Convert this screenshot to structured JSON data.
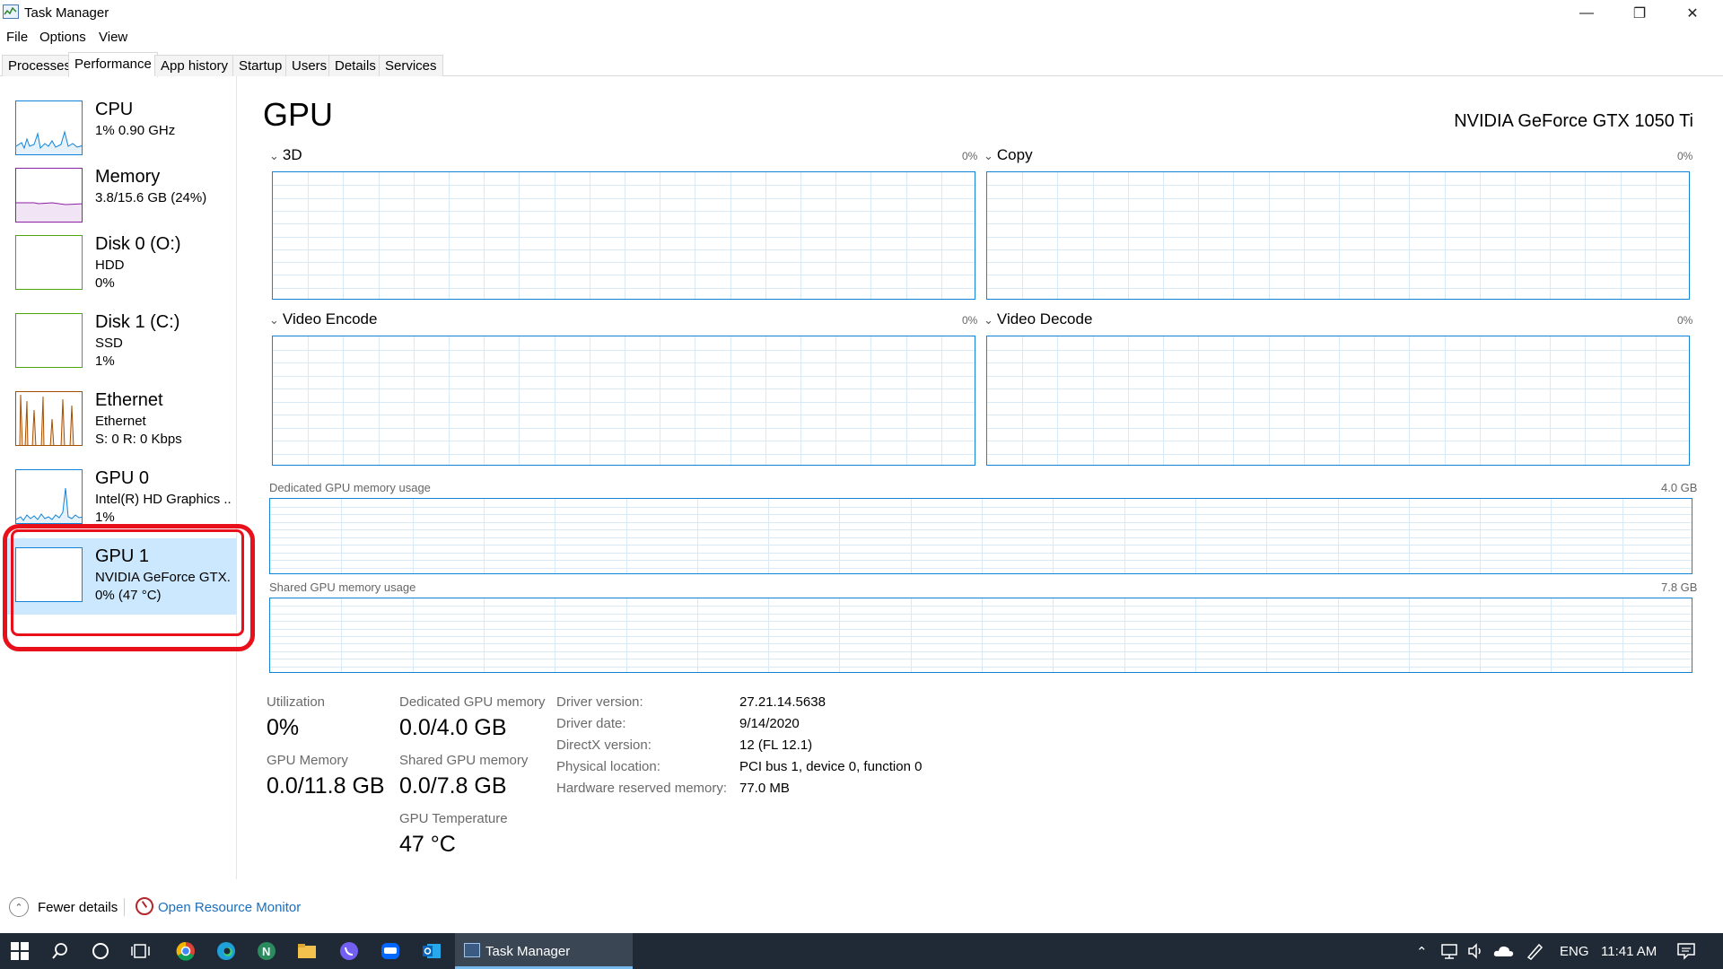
{
  "window": {
    "title": "Task Manager",
    "minimize": "—",
    "maximize": "❐",
    "close": "✕"
  },
  "menu": [
    "File",
    "Options",
    "View"
  ],
  "tabs": [
    "Processes",
    "Performance",
    "App history",
    "Startup",
    "Users",
    "Details",
    "Services"
  ],
  "active_tab": "Performance",
  "sidebar": {
    "items": [
      {
        "name": "CPU",
        "line1": "1%  0.90 GHz",
        "line2": "",
        "color": "#1183d9"
      },
      {
        "name": "Memory",
        "line1": "3.8/15.6 GB (24%)",
        "line2": "",
        "color": "#8b1fa6"
      },
      {
        "name": "Disk 0 (O:)",
        "line1": "HDD",
        "line2": "0%",
        "color": "#4da60c"
      },
      {
        "name": "Disk 1 (C:)",
        "line1": "SSD",
        "line2": "1%",
        "color": "#4da60c"
      },
      {
        "name": "Ethernet",
        "line1": "Ethernet",
        "line2": "S: 0  R: 0 Kbps",
        "color": "#a74f01"
      },
      {
        "name": "GPU 0",
        "line1": "Intel(R) HD Graphics ...",
        "line2": "1%",
        "color": "#1183d9"
      },
      {
        "name": "GPU 1",
        "line1": "NVIDIA GeForce GTX...",
        "line2": "0%  (47 °C)",
        "color": "#1183d9"
      }
    ],
    "selected": "GPU 1"
  },
  "main": {
    "heading": "GPU",
    "model": "NVIDIA GeForce GTX 1050 Ti",
    "engines": [
      {
        "name": "3D",
        "pct": "0%"
      },
      {
        "name": "Copy",
        "pct": "0%"
      },
      {
        "name": "Video Encode",
        "pct": "0%"
      },
      {
        "name": "Video Decode",
        "pct": "0%"
      }
    ],
    "dedicated_label": "Dedicated GPU memory usage",
    "dedicated_max": "4.0 GB",
    "shared_label": "Shared GPU memory usage",
    "shared_max": "7.8 GB",
    "stats": {
      "utilization_label": "Utilization",
      "utilization": "0%",
      "dedicated_mem_label": "Dedicated GPU memory",
      "dedicated_mem": "0.0/4.0 GB",
      "gpu_mem_label": "GPU Memory",
      "gpu_mem": "0.0/11.8 GB",
      "shared_mem_label": "Shared GPU memory",
      "shared_mem": "0.0/7.8 GB",
      "temp_label": "GPU Temperature",
      "temp": "47 °C"
    },
    "driver": [
      {
        "label": "Driver version:",
        "value": "27.21.14.5638"
      },
      {
        "label": "Driver date:",
        "value": "9/14/2020"
      },
      {
        "label": "DirectX version:",
        "value": "12 (FL 12.1)"
      },
      {
        "label": "Physical location:",
        "value": "PCI bus 1, device 0, function 0"
      },
      {
        "label": "Hardware reserved memory:",
        "value": "77.0 MB"
      }
    ]
  },
  "footer": {
    "fewer_details": "Fewer details",
    "open_resource_monitor": "Open Resource Monitor"
  },
  "taskbar": {
    "task_manager": "Task Manager",
    "language": "ENG",
    "time": "11:41 AM"
  }
}
